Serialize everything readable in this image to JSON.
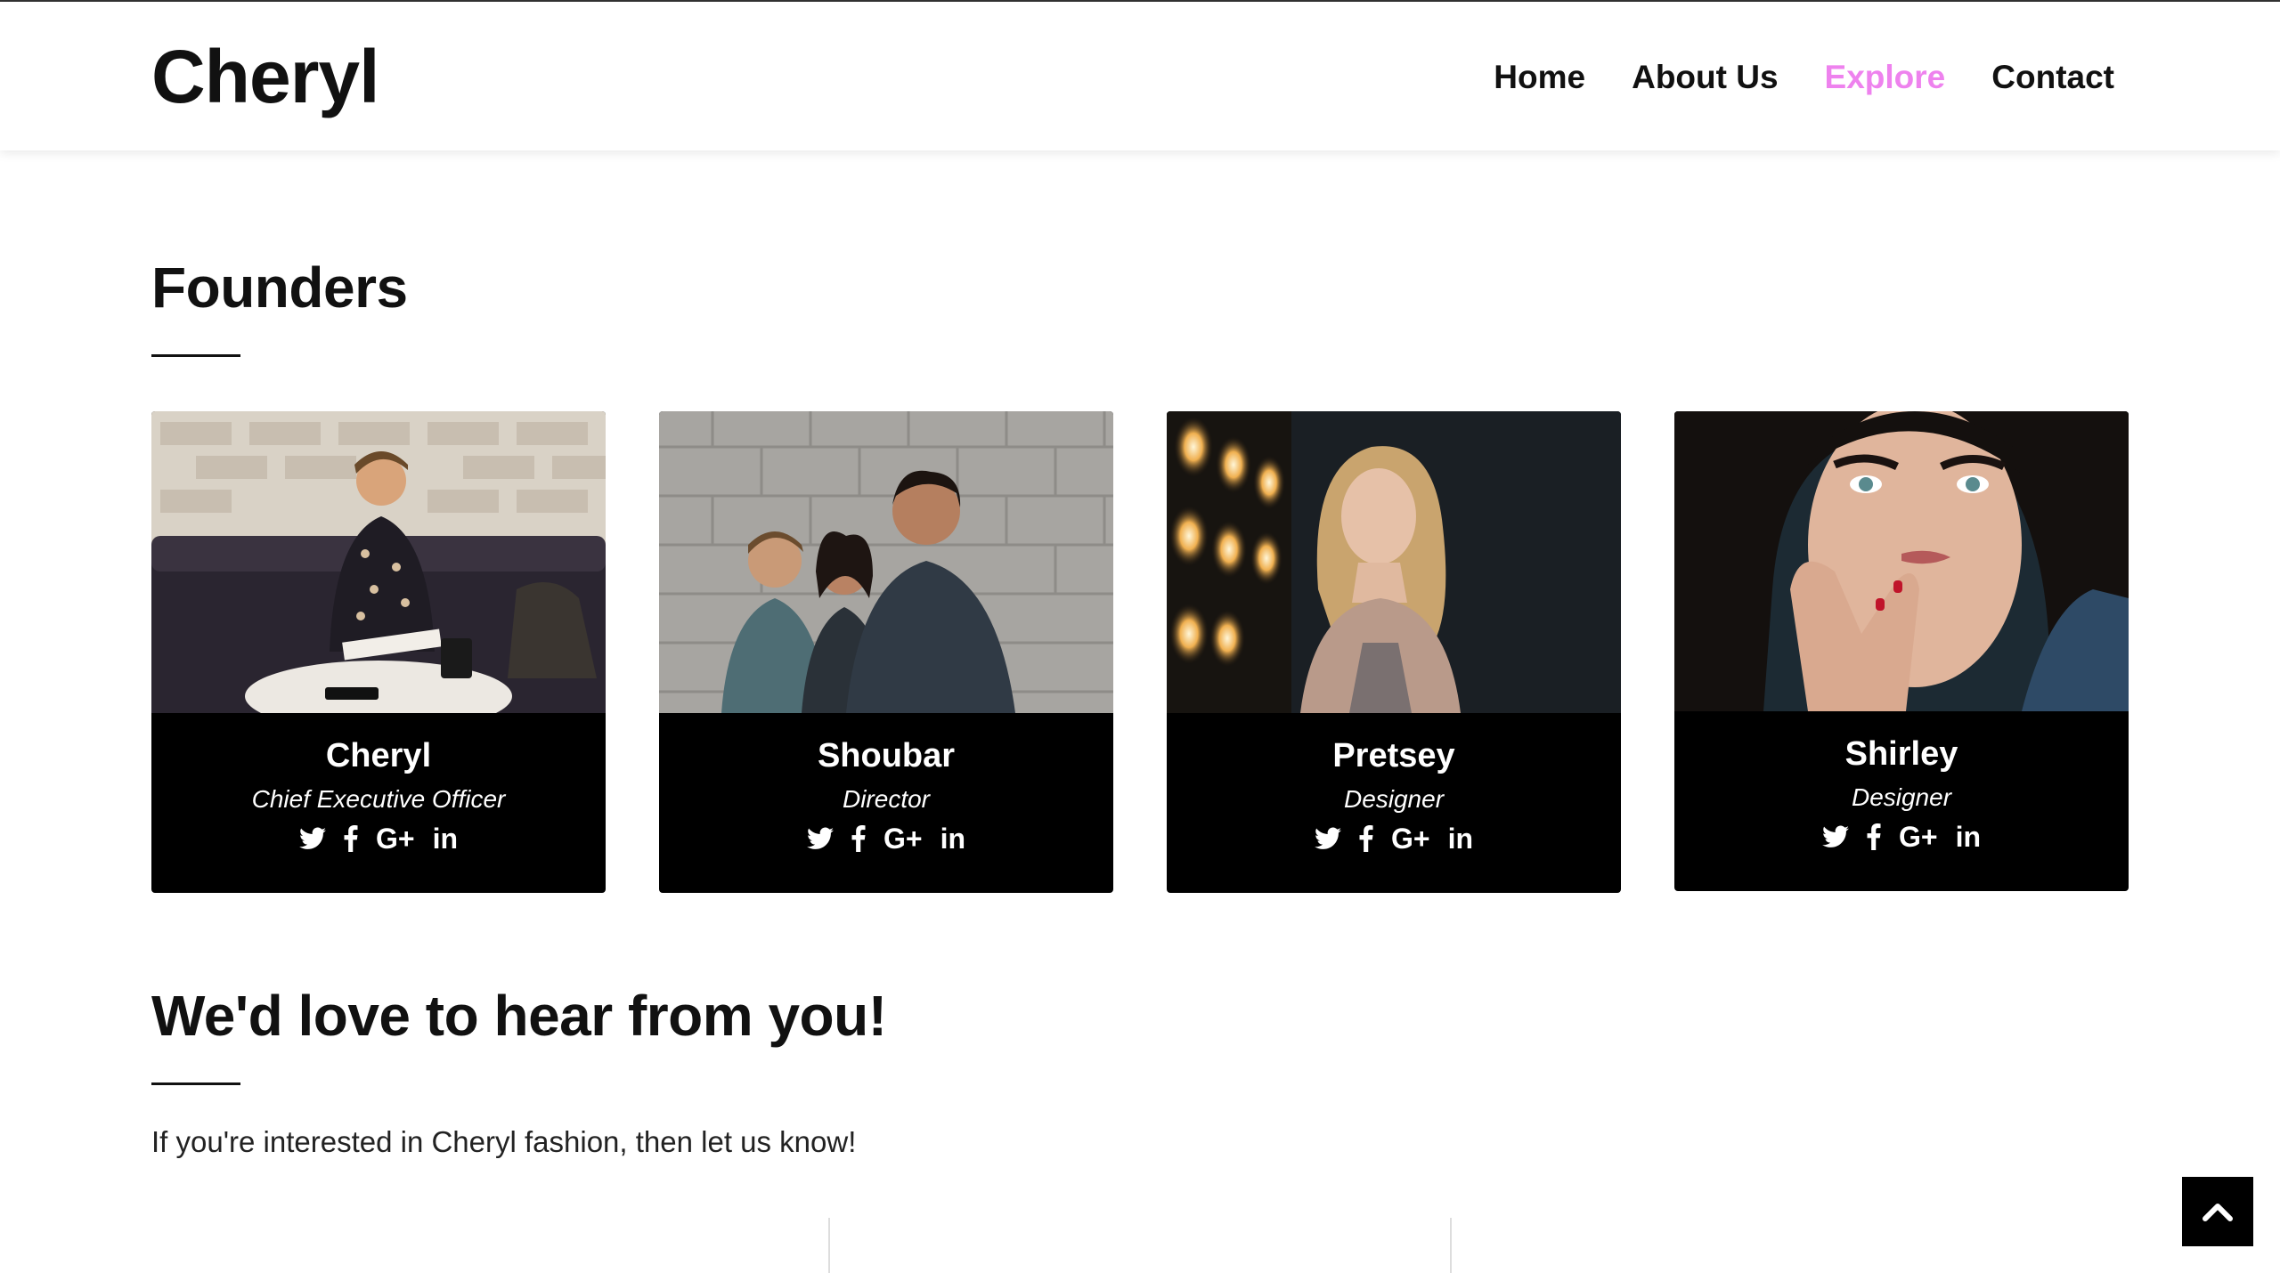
{
  "brand": "Cheryl",
  "nav": {
    "items": [
      {
        "label": "Home"
      },
      {
        "label": "About Us"
      },
      {
        "label": "Explore",
        "active": true
      },
      {
        "label": "Contact"
      }
    ],
    "active_color": "#ee82ee"
  },
  "founders": {
    "title": "Founders",
    "cards": [
      {
        "name": "Cheryl",
        "role": "Chief Executive Officer"
      },
      {
        "name": "Shoubar",
        "role": "Director"
      },
      {
        "name": "Pretsey",
        "role": "Designer"
      },
      {
        "name": "Shirley",
        "role": "Designer"
      }
    ],
    "social_icons": [
      "twitter-icon",
      "facebook-icon",
      "google-plus-icon",
      "linkedin-icon"
    ],
    "social_labels": {
      "googleplus": "G+",
      "linkedin": "in"
    }
  },
  "contact": {
    "title": "We'd love to hear from you!",
    "intro": "If you're interested in Cheryl fashion, then let us know!"
  },
  "scroll_top_icon": "chevron-up-icon"
}
